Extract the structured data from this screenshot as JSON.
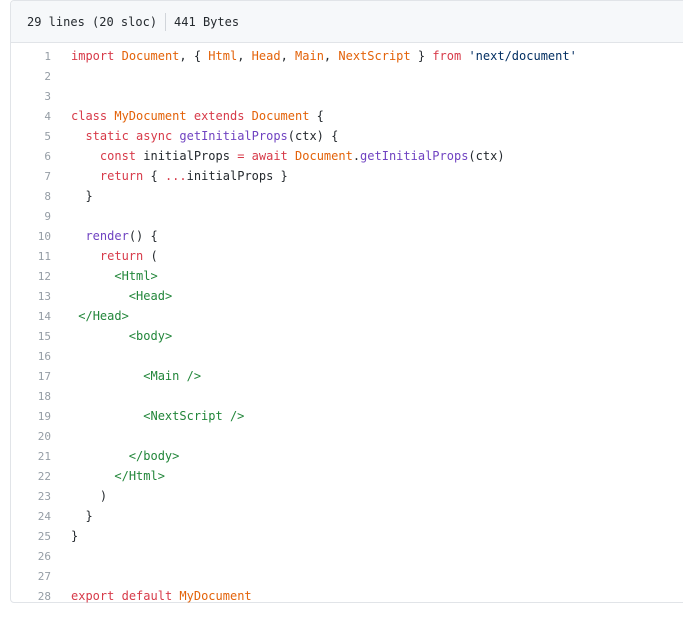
{
  "file_info": {
    "lines": "29 lines (20 sloc)",
    "size": "441 Bytes"
  },
  "colors": {
    "keyword": "#d73a49",
    "entity": "#e36209",
    "function": "#6f42c1",
    "string": "#032f62",
    "tag": "#22863a",
    "plain": "#24292e",
    "line_number": "#959da5"
  },
  "code_lines": [
    {
      "num": "1",
      "tokens": [
        [
          "kw",
          "import"
        ],
        [
          "plain",
          " "
        ],
        [
          "ent",
          "Document"
        ],
        [
          "plain",
          ", { "
        ],
        [
          "ent",
          "Html"
        ],
        [
          "plain",
          ", "
        ],
        [
          "ent",
          "Head"
        ],
        [
          "plain",
          ", "
        ],
        [
          "ent",
          "Main"
        ],
        [
          "plain",
          ", "
        ],
        [
          "ent",
          "NextScript"
        ],
        [
          "plain",
          " } "
        ],
        [
          "kw",
          "from"
        ],
        [
          "plain",
          " "
        ],
        [
          "str",
          "'next/document'"
        ]
      ]
    },
    {
      "num": "2",
      "tokens": []
    },
    {
      "num": "3",
      "tokens": []
    },
    {
      "num": "4",
      "tokens": [
        [
          "kw",
          "class"
        ],
        [
          "plain",
          " "
        ],
        [
          "ent",
          "MyDocument"
        ],
        [
          "plain",
          " "
        ],
        [
          "kw",
          "extends"
        ],
        [
          "plain",
          " "
        ],
        [
          "ent",
          "Document"
        ],
        [
          "plain",
          " {"
        ]
      ]
    },
    {
      "num": "5",
      "tokens": [
        [
          "plain",
          "  "
        ],
        [
          "kw",
          "static"
        ],
        [
          "plain",
          " "
        ],
        [
          "kw",
          "async"
        ],
        [
          "plain",
          " "
        ],
        [
          "fn",
          "getInitialProps"
        ],
        [
          "plain",
          "(ctx) {"
        ]
      ]
    },
    {
      "num": "6",
      "tokens": [
        [
          "plain",
          "    "
        ],
        [
          "kw",
          "const"
        ],
        [
          "plain",
          " initialProps "
        ],
        [
          "kw",
          "="
        ],
        [
          "plain",
          " "
        ],
        [
          "kw",
          "await"
        ],
        [
          "plain",
          " "
        ],
        [
          "ent",
          "Document"
        ],
        [
          "plain",
          "."
        ],
        [
          "fn",
          "getInitialProps"
        ],
        [
          "plain",
          "(ctx)"
        ]
      ]
    },
    {
      "num": "7",
      "tokens": [
        [
          "plain",
          "    "
        ],
        [
          "kw",
          "return"
        ],
        [
          "plain",
          " { "
        ],
        [
          "kw",
          "..."
        ],
        [
          "plain",
          "initialProps }"
        ]
      ]
    },
    {
      "num": "8",
      "tokens": [
        [
          "plain",
          "  }"
        ]
      ]
    },
    {
      "num": "9",
      "tokens": []
    },
    {
      "num": "10",
      "tokens": [
        [
          "plain",
          "  "
        ],
        [
          "fn",
          "render"
        ],
        [
          "plain",
          "() {"
        ]
      ]
    },
    {
      "num": "11",
      "tokens": [
        [
          "plain",
          "    "
        ],
        [
          "kw",
          "return"
        ],
        [
          "plain",
          " ("
        ]
      ]
    },
    {
      "num": "12",
      "tokens": [
        [
          "plain",
          "      "
        ],
        [
          "tag",
          "<"
        ],
        [
          "tag",
          "Html"
        ],
        [
          "tag",
          ">"
        ]
      ]
    },
    {
      "num": "13",
      "tokens": [
        [
          "plain",
          "        "
        ],
        [
          "tag",
          "<"
        ],
        [
          "tag",
          "Head"
        ],
        [
          "tag",
          ">"
        ]
      ]
    },
    {
      "num": "14",
      "tokens": [
        [
          "plain",
          " "
        ],
        [
          "tag",
          "</"
        ],
        [
          "tag",
          "Head"
        ],
        [
          "tag",
          ">"
        ]
      ]
    },
    {
      "num": "15",
      "tokens": [
        [
          "plain",
          "        "
        ],
        [
          "tag",
          "<"
        ],
        [
          "tag",
          "body"
        ],
        [
          "tag",
          ">"
        ]
      ]
    },
    {
      "num": "16",
      "tokens": []
    },
    {
      "num": "17",
      "tokens": [
        [
          "plain",
          "          "
        ],
        [
          "tag",
          "<"
        ],
        [
          "tag",
          "Main"
        ],
        [
          "tag",
          " />"
        ]
      ]
    },
    {
      "num": "18",
      "tokens": []
    },
    {
      "num": "19",
      "tokens": [
        [
          "plain",
          "          "
        ],
        [
          "tag",
          "<"
        ],
        [
          "tag",
          "NextScript"
        ],
        [
          "tag",
          " />"
        ]
      ]
    },
    {
      "num": "20",
      "tokens": []
    },
    {
      "num": "21",
      "tokens": [
        [
          "plain",
          "        "
        ],
        [
          "tag",
          "</"
        ],
        [
          "tag",
          "body"
        ],
        [
          "tag",
          ">"
        ]
      ]
    },
    {
      "num": "22",
      "tokens": [
        [
          "plain",
          "      "
        ],
        [
          "tag",
          "</"
        ],
        [
          "tag",
          "Html"
        ],
        [
          "tag",
          ">"
        ]
      ]
    },
    {
      "num": "23",
      "tokens": [
        [
          "plain",
          "    )"
        ]
      ]
    },
    {
      "num": "24",
      "tokens": [
        [
          "plain",
          "  }"
        ]
      ]
    },
    {
      "num": "25",
      "tokens": [
        [
          "plain",
          "}"
        ]
      ]
    },
    {
      "num": "26",
      "tokens": []
    },
    {
      "num": "27",
      "tokens": []
    },
    {
      "num": "28",
      "tokens": [
        [
          "kw",
          "export"
        ],
        [
          "plain",
          " "
        ],
        [
          "kw",
          "default"
        ],
        [
          "plain",
          " "
        ],
        [
          "ent",
          "MyDocument"
        ]
      ]
    }
  ]
}
